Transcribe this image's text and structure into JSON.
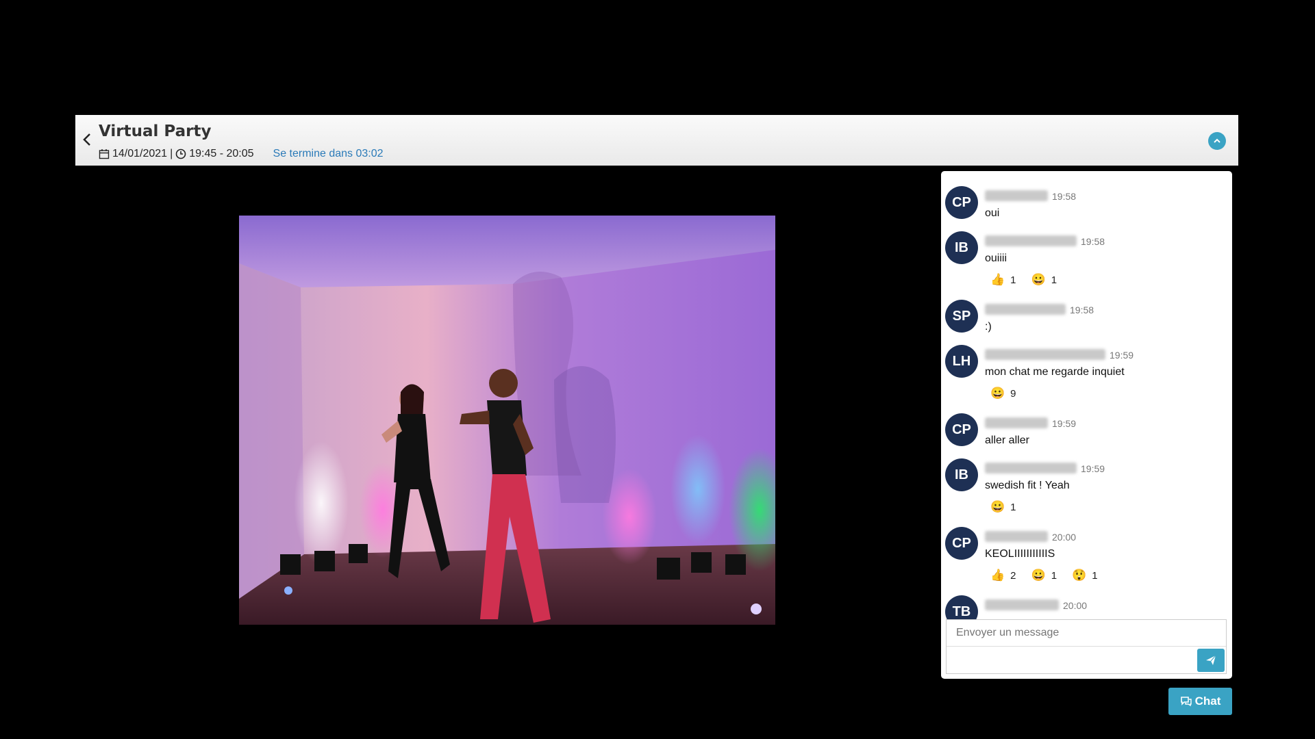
{
  "header": {
    "title": "Virtual Party",
    "date": "14/01/2021",
    "separator": "|",
    "time_range": "19:45 - 20:05",
    "countdown": "Se termine dans 03:02"
  },
  "chat": {
    "messages": [
      {
        "initials": "CP",
        "time": "19:58",
        "text": "oui",
        "reactions": []
      },
      {
        "initials": "IB",
        "time": "19:58",
        "text": "ouiiii",
        "reactions": [
          {
            "emoji": "👍",
            "count": "1"
          },
          {
            "emoji": "😀",
            "count": "1"
          }
        ]
      },
      {
        "initials": "SP",
        "time": "19:58",
        "text": ":)",
        "reactions": []
      },
      {
        "initials": "LH",
        "time": "19:59",
        "text": "mon chat me regarde inquiet",
        "reactions": [
          {
            "emoji": "😀",
            "count": "9"
          }
        ]
      },
      {
        "initials": "CP",
        "time": "19:59",
        "text": "aller aller",
        "reactions": []
      },
      {
        "initials": "IB",
        "time": "19:59",
        "text": "swedish fit ! Yeah",
        "reactions": [
          {
            "emoji": "😀",
            "count": "1"
          }
        ]
      },
      {
        "initials": "CP",
        "time": "20:00",
        "text": "KEOLIIIIIIIIIIIS",
        "reactions": [
          {
            "emoji": "👍",
            "count": "2"
          },
          {
            "emoji": "😀",
            "count": "1"
          },
          {
            "emoji": "😲",
            "count": "1"
          }
        ]
      },
      {
        "initials": "TB",
        "time": "20:00",
        "text": "",
        "reactions": []
      }
    ],
    "input_placeholder": "Envoyer un message",
    "toggle_label": "Chat"
  },
  "colors": {
    "accent": "#3aa3c4",
    "avatar_bg": "#1e3054",
    "link": "#2a7ab8"
  }
}
